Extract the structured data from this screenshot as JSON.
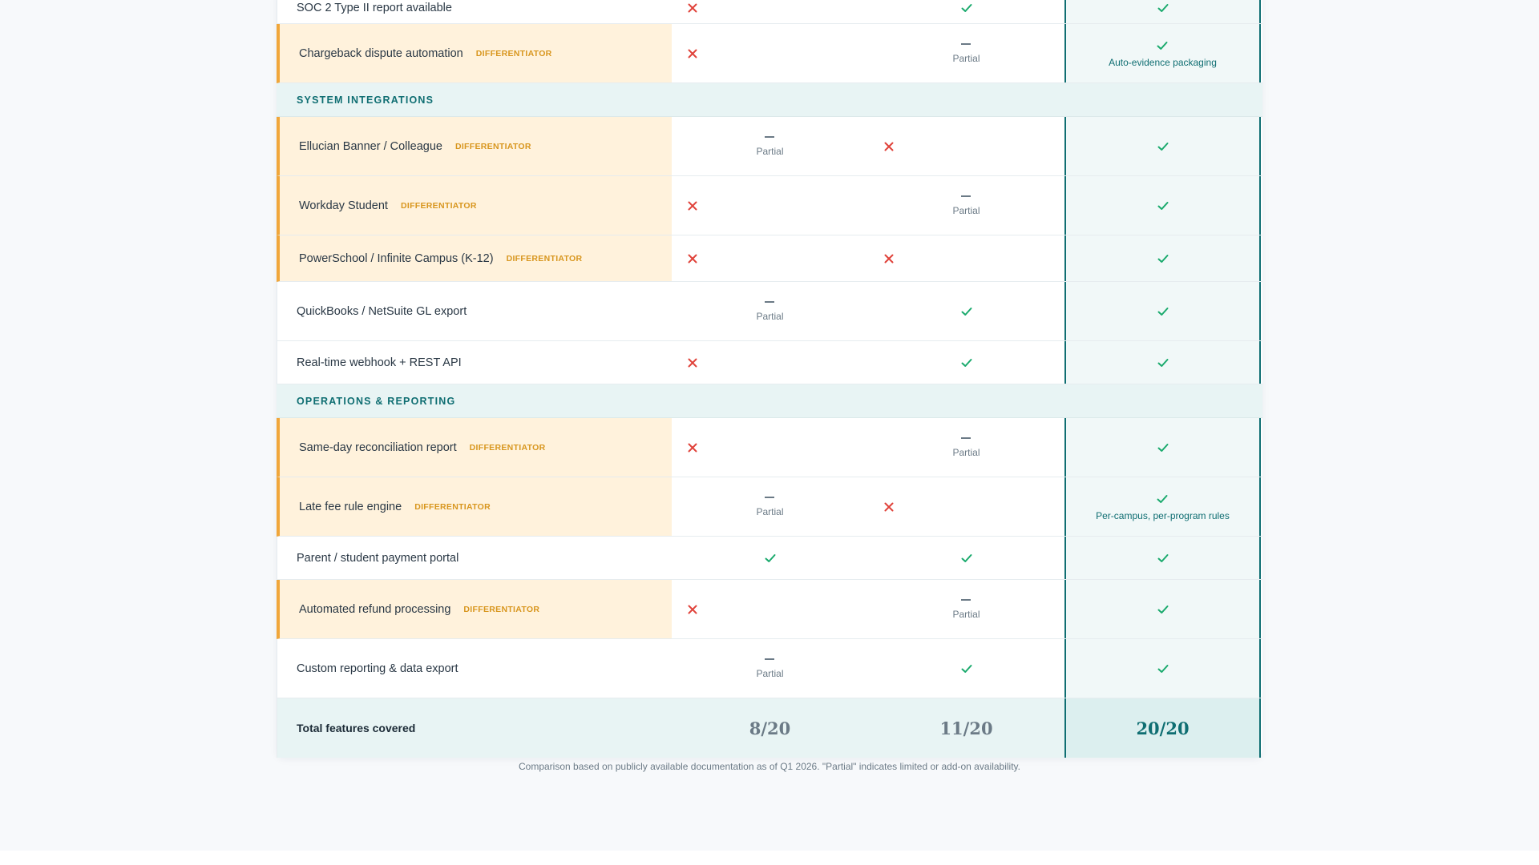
{
  "colors": {
    "accent": "#0f6e72",
    "differentiator": "#f0a63a",
    "check": "#1aaa6d",
    "cross": "#e0423a",
    "muted": "#6b7a86"
  },
  "labels": {
    "badge": "DIFFERENTIATOR",
    "partial": "Partial"
  },
  "rows": [
    {
      "feature": "SOC 2 Type II report available",
      "diff": false,
      "a": "no",
      "b": "yes",
      "c": "yes"
    },
    {
      "feature": "Chargeback dispute automation",
      "diff": true,
      "a": "no",
      "b": "partial",
      "c": "yes",
      "c_note": "Auto-evidence packaging"
    }
  ],
  "sections": [
    {
      "title": "SYSTEM INTEGRATIONS",
      "rows": [
        {
          "feature": "Ellucian Banner / Colleague",
          "diff": true,
          "a": "partial",
          "b": "no",
          "c": "yes"
        },
        {
          "feature": "Workday Student",
          "diff": true,
          "a": "no",
          "b": "partial",
          "c": "yes"
        },
        {
          "feature": "PowerSchool / Infinite Campus (K-12)",
          "diff": true,
          "a": "no",
          "b": "no",
          "c": "yes"
        },
        {
          "feature": "QuickBooks / NetSuite GL export",
          "diff": false,
          "a": "partial",
          "b": "yes",
          "c": "yes"
        },
        {
          "feature": "Real-time webhook + REST API",
          "diff": false,
          "a": "no",
          "b": "yes",
          "c": "yes"
        }
      ]
    },
    {
      "title": "OPERATIONS & REPORTING",
      "rows": [
        {
          "feature": "Same-day reconciliation report",
          "diff": true,
          "a": "no",
          "b": "partial",
          "c": "yes"
        },
        {
          "feature": "Late fee rule engine",
          "diff": true,
          "a": "partial",
          "b": "no",
          "c": "yes",
          "c_note": "Per-campus, per-program rules"
        },
        {
          "feature": "Parent / student payment portal",
          "diff": false,
          "a": "yes",
          "b": "yes",
          "c": "yes"
        },
        {
          "feature": "Automated refund processing",
          "diff": true,
          "a": "no",
          "b": "partial",
          "c": "yes"
        },
        {
          "feature": "Custom reporting & data export",
          "diff": false,
          "a": "partial",
          "b": "yes",
          "c": "yes"
        }
      ]
    }
  ],
  "total": {
    "label": "Total features covered",
    "a": "8/20",
    "b": "11/20",
    "c": "20/20"
  },
  "footnote": "Comparison based on publicly available documentation as of Q1 2026. \"Partial\" indicates limited or add-on availability."
}
